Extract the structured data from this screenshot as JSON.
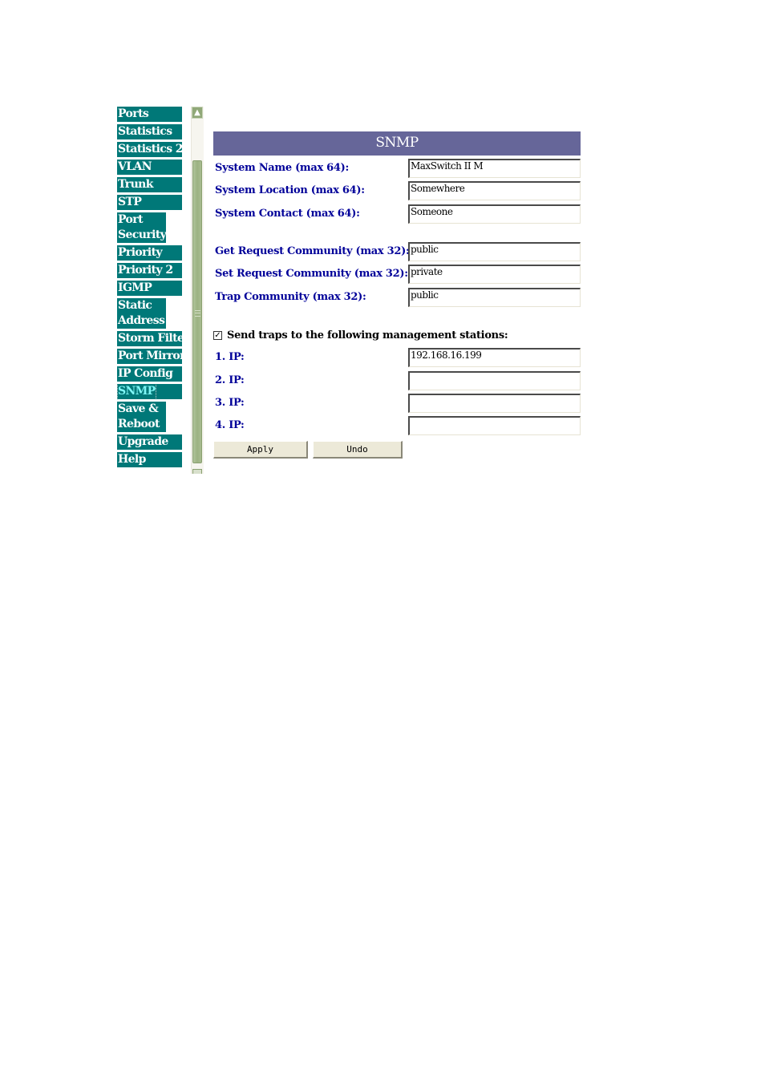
{
  "sidebar": {
    "items": [
      {
        "label": "Ports"
      },
      {
        "label": "Statistics"
      },
      {
        "label": "Statistics 2"
      },
      {
        "label": "VLAN"
      },
      {
        "label": "Trunk"
      },
      {
        "label": "STP"
      },
      {
        "label": "Port Security"
      },
      {
        "label": "Priority"
      },
      {
        "label": "Priority 2"
      },
      {
        "label": "IGMP"
      },
      {
        "label": "Static Address"
      },
      {
        "label": "Storm Filter"
      },
      {
        "label": "Port Mirror"
      },
      {
        "label": "IP Config"
      },
      {
        "label": "SNMP",
        "active": true
      },
      {
        "label": "Save & Reboot"
      },
      {
        "label": "Upgrade"
      },
      {
        "label": "Help"
      }
    ]
  },
  "colors": {
    "nav_bg": "#007878",
    "title_bg": "#666699",
    "label_text": "#000099",
    "active_nav_text": "#7ff5f5"
  },
  "main": {
    "title": "SNMP",
    "fields": [
      {
        "label": "System Name (max 64):",
        "value": "MaxSwitch II M"
      },
      {
        "label": "System Location (max 64):",
        "value": "Somewhere"
      },
      {
        "label": "System Contact (max 64):",
        "value": "Someone"
      },
      {
        "label": "Get Request Community (max 32):",
        "value": "public"
      },
      {
        "label": "Set Request Community (max 32):",
        "value": "private"
      },
      {
        "label": "Trap Community (max 32):",
        "value": "public"
      }
    ],
    "send_traps": {
      "checked": true,
      "label": "Send traps to the following management stations:"
    },
    "ips": [
      {
        "label": "1. IP:",
        "value": "192.168.16.199"
      },
      {
        "label": "2. IP:",
        "value": ""
      },
      {
        "label": "3. IP:",
        "value": ""
      },
      {
        "label": "4. IP:",
        "value": ""
      }
    ],
    "buttons": {
      "apply": "Apply",
      "undo": "Undo"
    },
    "checkmark": "✓"
  }
}
